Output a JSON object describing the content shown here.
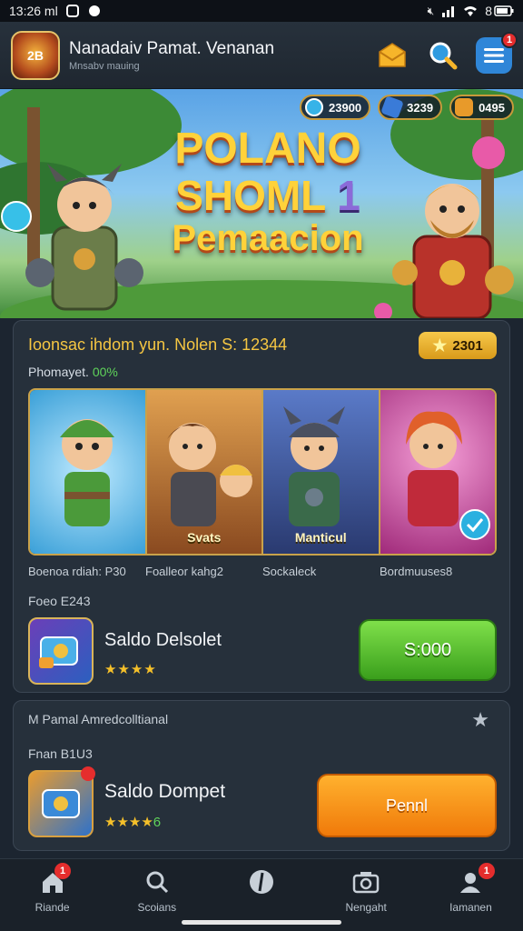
{
  "status_bar": {
    "time": "13:26 ml",
    "battery": "8"
  },
  "header": {
    "logo_text": "2B",
    "title": "Nanadaiv Pamat. Venanan",
    "subtitle": "Mnsabv mauing",
    "menu_badge": "1"
  },
  "banner": {
    "currencies": [
      {
        "value": "23900",
        "color": "#37b3e8"
      },
      {
        "value": "3239",
        "color": "#3a7bd8"
      },
      {
        "value": "0495",
        "color": "#e89a2a"
      }
    ],
    "title_line1": "POLANO",
    "title_line2": "SHOML",
    "title_num": "1",
    "title_line3": "Pemaacion"
  },
  "game_card": {
    "title": "Ioonsac ihdom yun. Nolen S: 12344",
    "rating": "2301",
    "progress_label": "Phomayet.",
    "progress_value": "00%",
    "characters": [
      {
        "tag": "",
        "bg": "#3aa0d8"
      },
      {
        "tag": "Svats",
        "bg": "#b66a2a"
      },
      {
        "tag": "Manticul",
        "bg": "#3f5fa6"
      },
      {
        "tag": "",
        "bg": "#c43a8f"
      }
    ],
    "char_labels": [
      "Boenoa rdiah: P30",
      "Foalleor kahg2",
      "Sockaleck",
      "Bordmuuses8"
    ],
    "offer": {
      "price_label": "Foeo E243",
      "name": "Saldo Delsolet",
      "stars": "★★★★",
      "button": "S:000"
    }
  },
  "card2": {
    "title": "M Pamal Amredcolltianal",
    "price_label": "Fnan B1U3",
    "name": "Saldo Dompet",
    "stars": "★★★★",
    "stars_num": "6",
    "button": "Pennl"
  },
  "nav": [
    {
      "label": "Riande",
      "icon": "home-icon",
      "badge": "1"
    },
    {
      "label": "Scoians",
      "icon": "search-icon",
      "badge": ""
    },
    {
      "label": "",
      "icon": "compass-icon",
      "badge": ""
    },
    {
      "label": "Nengaht",
      "icon": "camera-icon",
      "badge": ""
    },
    {
      "label": "Iamanen",
      "icon": "profile-icon",
      "badge": "1"
    }
  ]
}
